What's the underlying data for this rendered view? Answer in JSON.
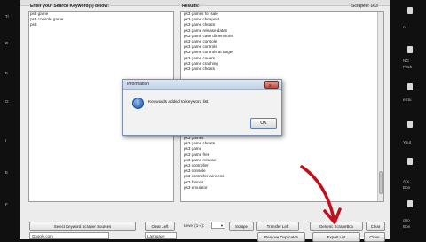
{
  "window": {
    "keywords_label": "Enter your Search Keyword(s) below:",
    "results_label": "Results:",
    "scraped_label": "Scraped: 163"
  },
  "keywords": [
    "ps3 game",
    "ps3 console game",
    "ps3"
  ],
  "results_top": [
    "ps3 games for sale",
    "ps3 game cheapest",
    "ps3 game cheats",
    "ps3 game release dates",
    "ps3 game case dimensions",
    "ps3 game console",
    "ps3 game controls",
    "ps3 game controls at target",
    "ps3 game covers",
    "ps3 game crashing",
    "ps3 game cheats"
  ],
  "results_bottom": [
    "ps3 games",
    "ps3 game cheats",
    "ps3 game",
    "ps3 game free",
    "ps3 game release",
    "ps3 controller",
    "ps3 console",
    "ps3 controller wireless",
    "ps3 friends",
    "ps3 emulator"
  ],
  "left_buttons": {
    "scraper_sources": "Select Keyword Scraper Sources",
    "clear_left": "Clear Left"
  },
  "right_buttons": {
    "level": "Level (1-4):",
    "scrape": "Scrape",
    "transfer_left": "Transfer Left",
    "generic_scrapebox": "Generic ScrapeBox",
    "clear": "Clear"
  },
  "bottom_bar": {
    "source_select": "Google.com",
    "language_select": "Language",
    "remove_duplicates": "Remove Duplicates",
    "export_list": "Export List",
    "close": "Close"
  },
  "dialog": {
    "title": "Information",
    "message": "Keywords added to keyword list.",
    "ok_label": "OK",
    "close_glyph": "x"
  },
  "right_strip": [
    "ru",
    "",
    "NG",
    "Pack",
    "",
    "eStu",
    "",
    "",
    "Yout",
    "",
    "Arx",
    "Bon",
    "",
    "ctro",
    "Bon"
  ],
  "left_strip": [
    "Ti",
    "D",
    "",
    "E",
    "",
    "G",
    "",
    "I",
    "",
    "E",
    "",
    "F"
  ]
}
